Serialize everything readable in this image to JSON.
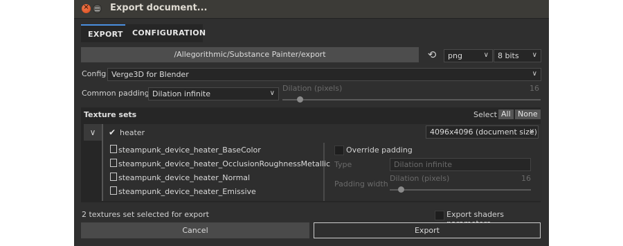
{
  "window": {
    "title": "Export document..."
  },
  "tabs": [
    {
      "label": "EXPORT",
      "active": true
    },
    {
      "label": "CONFIGURATION",
      "active": false
    }
  ],
  "export": {
    "path": "/Allegorithmic/Substance Painter/export",
    "format": "png",
    "bit_depth": "8 bits",
    "config_label": "Config",
    "config_value": "Verge3D for Blender",
    "padding_label": "Common padding",
    "padding_value": "Dilation infinite",
    "dilation_label": "Dilation (pixels)",
    "dilation_value": "16"
  },
  "texture_sets": {
    "title": "Texture sets",
    "select_label": "Select",
    "all_label": "All",
    "none_label": "None",
    "set_name": "heater",
    "size_value": "4096x4096 (document size)",
    "files": [
      "steampunk_device_heater_BaseColor",
      "steampunk_device_heater_OcclusionRoughnessMetallic",
      "steampunk_device_heater_Normal",
      "steampunk_device_heater_Emissive"
    ],
    "override_label": "Override padding",
    "type_label": "Type",
    "type_value": "Dilation infinite",
    "padding_width_label": "Padding width",
    "sub_dilation_label": "Dilation (pixels)",
    "sub_dilation_value": "16"
  },
  "footer": {
    "status": "2 textures set selected for export",
    "export_shaders_label": "Export shaders parameters",
    "cancel_label": "Cancel",
    "export_label": "Export"
  },
  "colors": {
    "accent": "#4a8fe0",
    "window_bg": "#2f2f2f",
    "panel_bg": "#262626"
  }
}
